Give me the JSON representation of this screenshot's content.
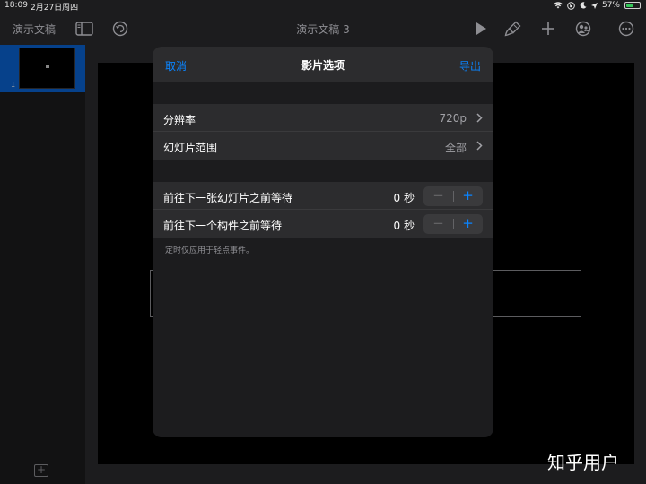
{
  "status_bar": {
    "time": "18:09",
    "date": "2月27日周四",
    "battery": "57%",
    "battery_level": 0.57
  },
  "toolbar": {
    "documents_label": "演示文稿",
    "document_title": "演示文稿 3"
  },
  "sidebar": {
    "slides": [
      {
        "number": "1"
      }
    ]
  },
  "modal": {
    "cancel_label": "取消",
    "title": "影片选项",
    "export_label": "导出",
    "settings": [
      {
        "label": "分辨率",
        "value": "720p"
      },
      {
        "label": "幻灯片范围",
        "value": "全部"
      }
    ],
    "timings": [
      {
        "label": "前往下一张幻灯片之前等待",
        "value": "0 秒",
        "minus": "−",
        "plus": "+"
      },
      {
        "label": "前往下一个构件之前等待",
        "value": "0 秒",
        "minus": "−",
        "plus": "+"
      }
    ],
    "footnote": "定时仅应用于轻点事件。"
  },
  "watermark": "知乎用户",
  "colors": {
    "accent": "#0a84ff",
    "selection": "#0a64d6",
    "battery": "#34c759"
  }
}
